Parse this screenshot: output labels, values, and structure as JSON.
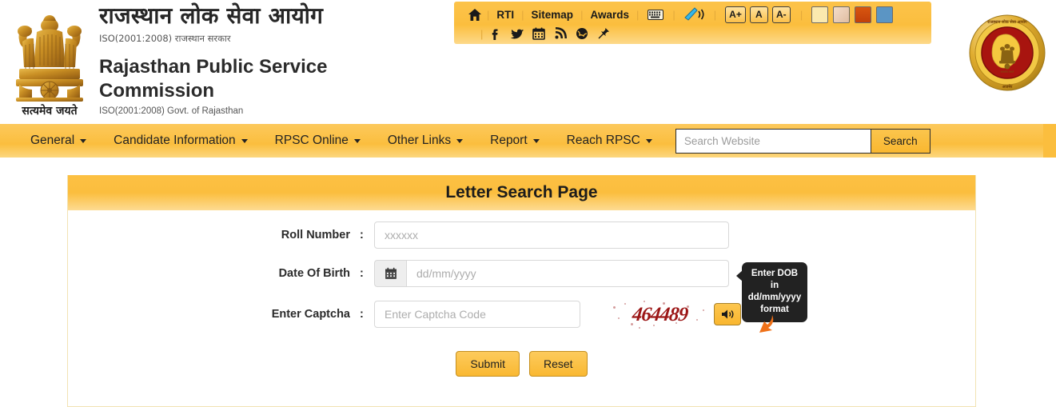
{
  "header": {
    "hindi_title": "राजस्थान लोक सेवा आयोग",
    "hindi_subtitle": "ISO(2001:2008) राजस्थान सरकार",
    "english_title": "Rajasthan Public Service Commission",
    "english_subtitle": "ISO(2001:2008) Govt. of Rajasthan",
    "emblem_motto": "सत्यमेव जयते",
    "emblem_name": "ashoka-lion-capital-emblem",
    "seal_name": "rpsc-official-seal"
  },
  "topbar": {
    "home_icon": "home-icon",
    "links": [
      "RTI",
      "Sitemap",
      "Awards"
    ],
    "keyboard_icon": "keyboard-icon",
    "accessibility_icon": "screen-reader-icon",
    "font_buttons": [
      "A+",
      "A",
      "A-"
    ],
    "theme_colors": [
      "#fbe9ae",
      "#e7c4a8",
      "#d2500f",
      "#5b95c4"
    ],
    "social_icons": [
      "facebook-icon",
      "twitter-icon",
      "calendar-icon",
      "rss-icon",
      "globe-icon",
      "pin-icon"
    ]
  },
  "nav": {
    "items": [
      {
        "label": "General",
        "has_caret": true
      },
      {
        "label": "Candidate Information",
        "has_caret": true
      },
      {
        "label": "RPSC Online",
        "has_caret": true
      },
      {
        "label": "Other Links",
        "has_caret": true
      },
      {
        "label": "Report",
        "has_caret": true
      },
      {
        "label": "Reach RPSC",
        "has_caret": true
      }
    ],
    "search_placeholder": "Search Website",
    "search_value": "",
    "search_button": "Search"
  },
  "panel": {
    "title": "Letter Search Page",
    "fields": [
      {
        "label": "Roll Number",
        "colon": ":",
        "placeholder": "xxxxxx",
        "value": ""
      },
      {
        "label": "Date Of Birth",
        "colon": ":",
        "placeholder": "dd/mm/yyyy",
        "value": ""
      },
      {
        "label": "Enter Captcha",
        "colon": ":",
        "placeholder": "Enter Captcha Code",
        "value": ""
      }
    ],
    "calendar_icon": "calendar-icon",
    "captcha_text": "464489",
    "captcha_audio_icon": "speaker-icon",
    "tooltip_text": "Enter DOB in dd/mm/yyyy format",
    "buttons": {
      "submit": "Submit",
      "reset": "Reset"
    }
  }
}
